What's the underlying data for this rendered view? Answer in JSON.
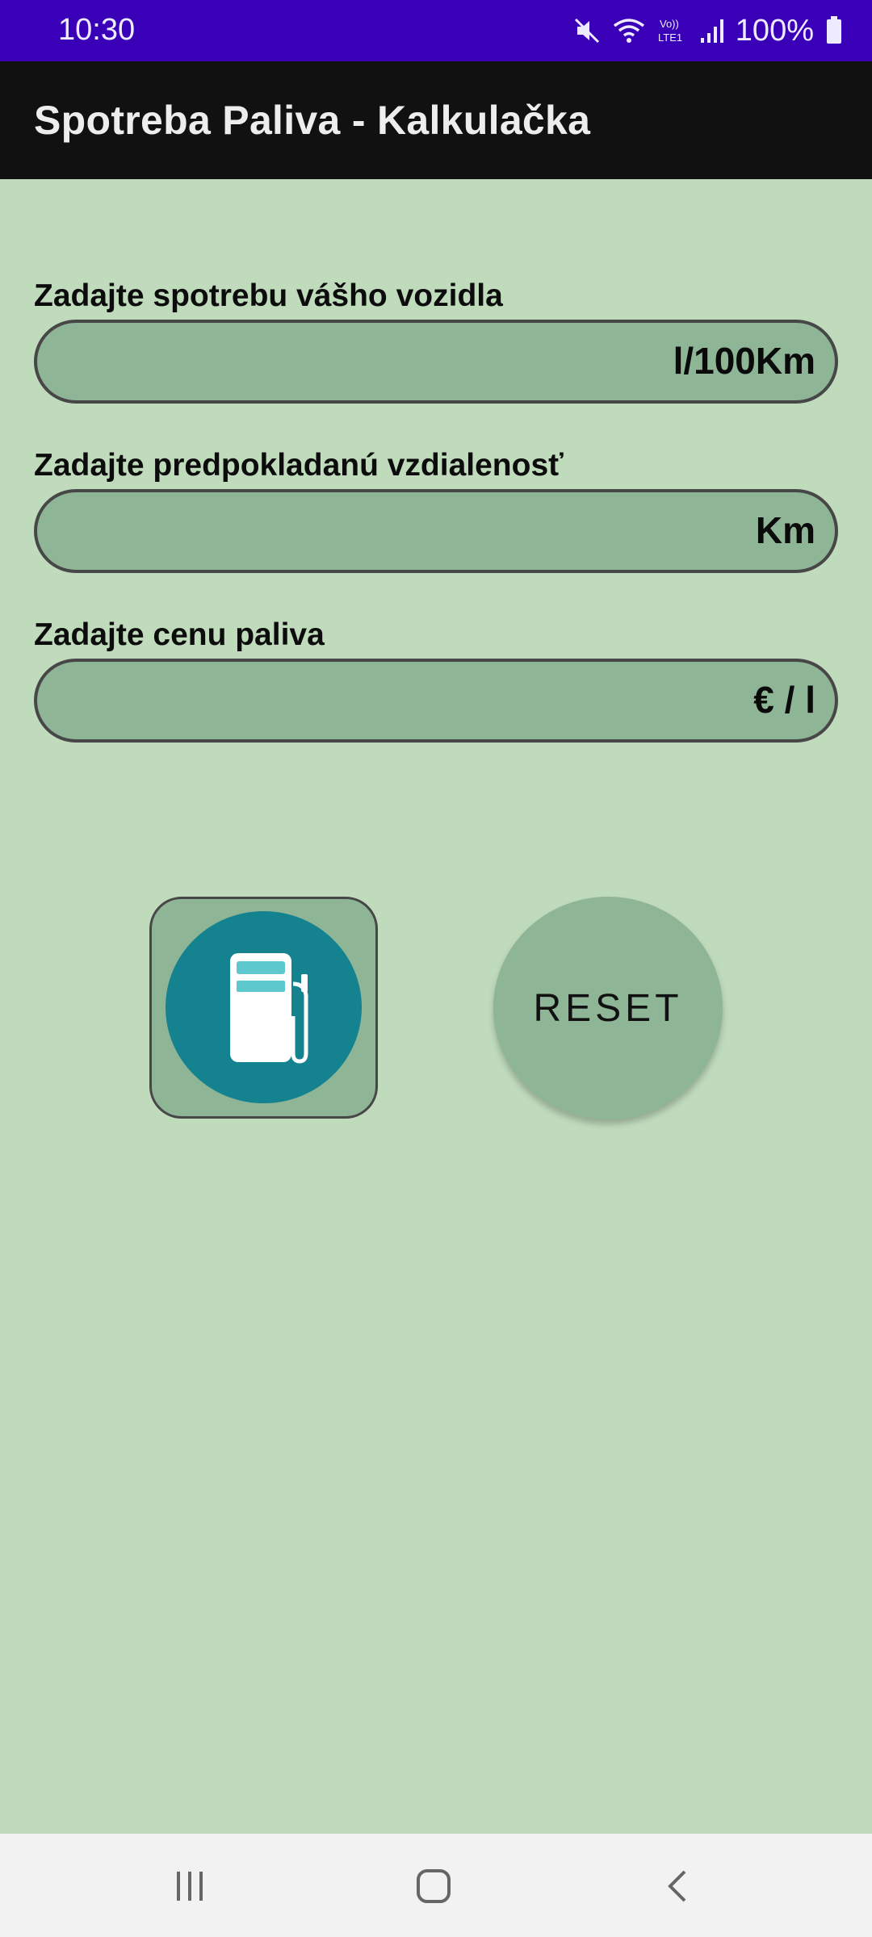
{
  "status_bar": {
    "time": "10:30",
    "battery": "100%",
    "icons": [
      "mute-icon",
      "wifi-icon",
      "volte-icon",
      "signal-icon",
      "battery-icon"
    ],
    "background": "#3a00b8"
  },
  "app_bar": {
    "title": "Spotreba Paliva - Kalkulačka",
    "background": "#111111"
  },
  "form": {
    "consumption": {
      "label": "Zadajte spotrebu vášho vozidla",
      "value": "",
      "unit": "l/100Km"
    },
    "distance": {
      "label": "Zadajte predpokladanú vzdialenosť",
      "value": "",
      "unit": "Km"
    },
    "price": {
      "label": "Zadajte cenu paliva",
      "value": "",
      "unit": "€ / l"
    }
  },
  "buttons": {
    "calculate_icon": "fuel-pump-icon",
    "reset_label": "RESET"
  },
  "nav_bar": {
    "icons": [
      "recent-apps-icon",
      "home-icon",
      "back-icon"
    ]
  },
  "colors": {
    "page_background": "#bfdbbc",
    "field_background": "#8fb597",
    "icon_circle": "#158290"
  }
}
